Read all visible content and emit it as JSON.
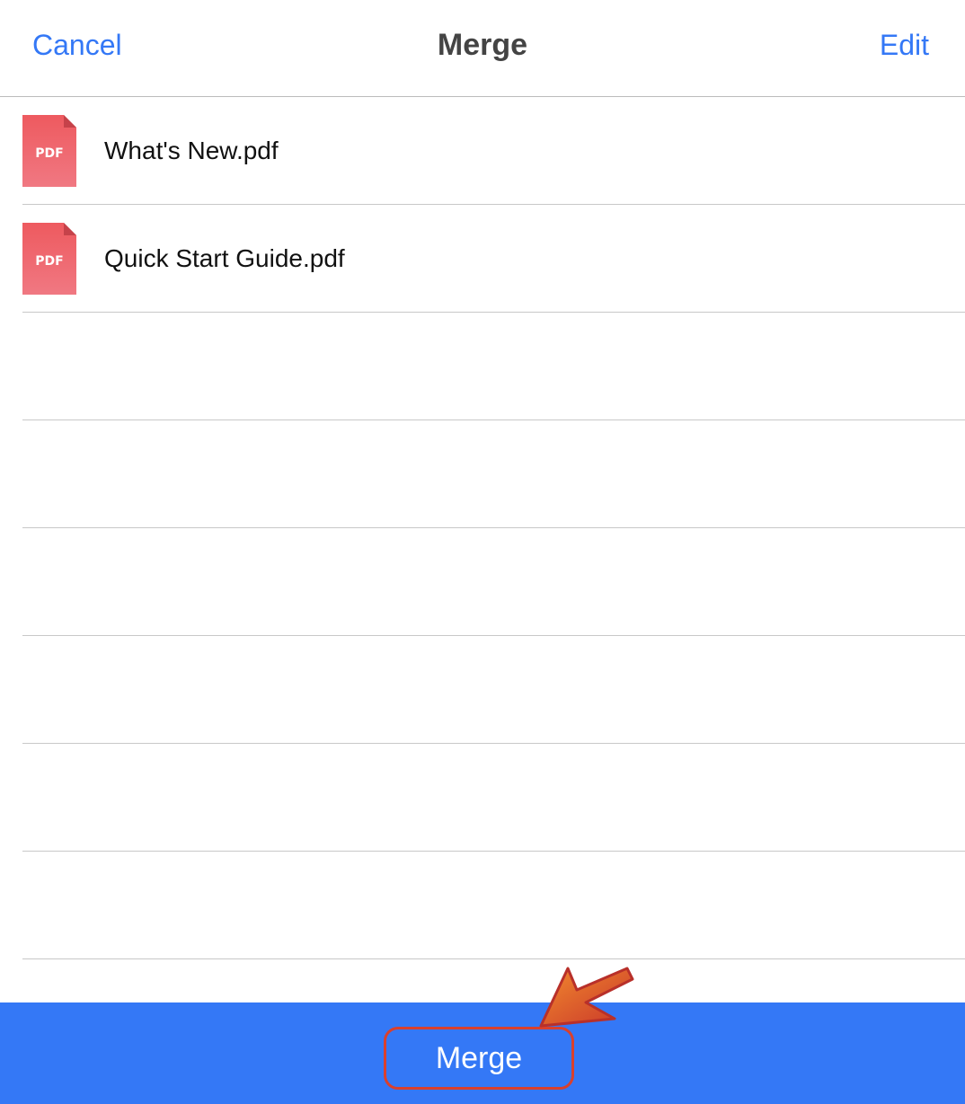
{
  "nav": {
    "cancel_label": "Cancel",
    "title": "Merge",
    "edit_label": "Edit"
  },
  "files": [
    {
      "name": "What's New.pdf",
      "icon": "pdf-icon",
      "icon_label": "PDF"
    },
    {
      "name": "Quick Start Guide.pdf",
      "icon": "pdf-icon",
      "icon_label": "PDF"
    }
  ],
  "bottom_bar": {
    "merge_label": "Merge"
  },
  "colors": {
    "accent": "#3478f6",
    "pdf_red": "#ee5a63",
    "highlight": "#d9402d"
  }
}
